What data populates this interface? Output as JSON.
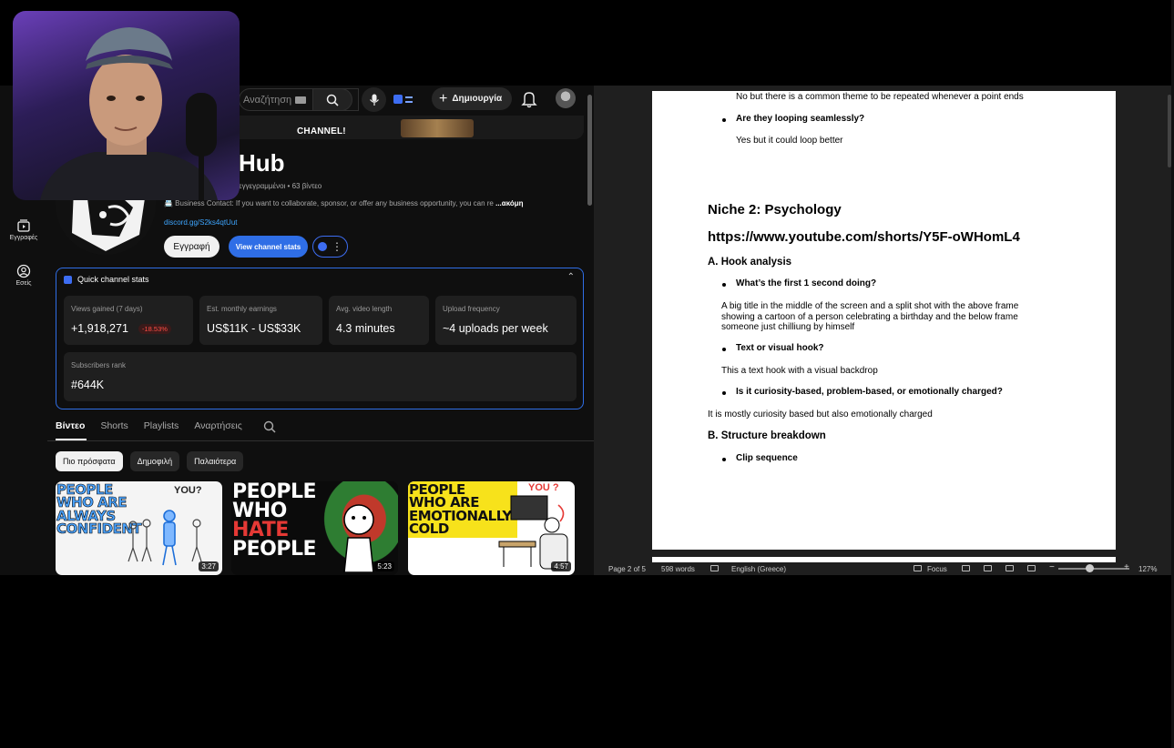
{
  "youtube": {
    "rail": [
      {
        "label": "Εγγραφές",
        "icon": "subscriptions-icon"
      },
      {
        "label": "Εσείς",
        "icon": "you-icon"
      }
    ],
    "topbar": {
      "search_placeholder": "Αναζήτηση",
      "create_label": "Δημιουργία"
    },
    "banner_text": "CHANNEL!",
    "channel": {
      "title": "Hub",
      "meta": "ι εγγεγραμμένοι • 63 βίντεο",
      "description": "📇 Business Contact: If you want to collaborate, sponsor, or offer any business opportunity, you can re",
      "more": "...ακόμη",
      "link": "discord.gg/S2ks4qtUut",
      "subscribe_label": "Εγγραφή",
      "stats_button_label": "View channel stats"
    },
    "quick_stats": {
      "title": "Quick channel stats",
      "cards": [
        {
          "label": "Views gained (7 days)",
          "value": "+1,918,271",
          "delta": "-18.53%"
        },
        {
          "label": "Est. monthly earnings",
          "value": "US$11K - US$33K"
        },
        {
          "label": "Avg. video length",
          "value": "4.3 minutes"
        },
        {
          "label": "Upload frequency",
          "value": "~4 uploads per week"
        },
        {
          "label": "Subscribers rank",
          "value": "#644K"
        }
      ]
    },
    "tabs": [
      "Βίντεο",
      "Shorts",
      "Playlists",
      "Αναρτήσεις"
    ],
    "chips": [
      "Πιο πρόσφατα",
      "Δημοφιλή",
      "Παλαιότερα"
    ],
    "videos": [
      {
        "title_lines": [
          "PEOPLE",
          "WHO ARE",
          "ALWAYS",
          "CONFIDENT"
        ],
        "thumb_side_text": "YOU?",
        "duration": "3:27"
      },
      {
        "title_lines": [
          "PEOPLE",
          "WHO",
          "HATE",
          "PEOPLE"
        ],
        "duration": "5:23"
      },
      {
        "title_lines": [
          "PEOPLE",
          "WHO ARE",
          "EMOTIONALLY",
          "COLD"
        ],
        "thumb_side_text": "YOU ?",
        "duration": "4:57"
      }
    ]
  },
  "document": {
    "lines": {
      "l1": "No but there is a common theme to be repeated whenever a point ends",
      "l2": "Are they looping seamlessly?",
      "l3": "Yes but it could loop better",
      "niche_heading": "Niche 2: Psychology",
      "url": "https://www.youtube.com/shorts/Y5F-oWHomL4",
      "hook_heading": "A. Hook analysis",
      "q1": "What’s the first 1 second doing?",
      "a1": "A big title in the middle of the screen and a split shot with the above frame showing a cartoon of a person celebrating a birthday and the below frame someone just chilliung by himself",
      "q2": "Text or visual hook?",
      "a2": "This a text hook with a visual backdrop",
      "q3": "Is it curiosity-based, problem-based, or emotionally charged?",
      "a3": "It is mostly curiosity based but also emotionally charged",
      "structure_heading": "B. Structure breakdown",
      "q4": "Clip sequence"
    },
    "status": {
      "page": "Page 2 of 5",
      "words": "598 words",
      "language": "English (Greece)",
      "focus": "Focus",
      "zoom": "127%"
    }
  }
}
